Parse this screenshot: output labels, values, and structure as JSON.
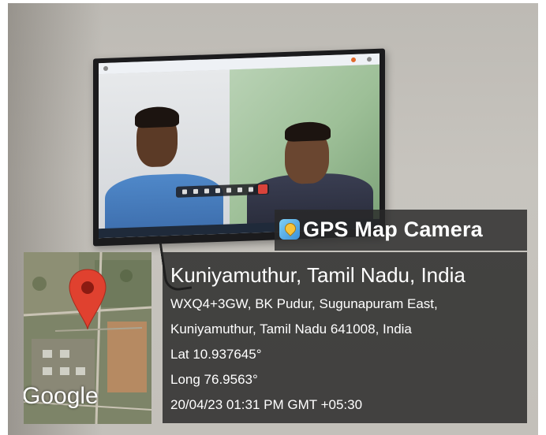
{
  "overlay": {
    "app_name": "GPS Map Camera",
    "place_title": "Kuniyamuthur, Tamil Nadu, India",
    "address_line1": "WXQ4+3GW, BK Pudur, Sugunapuram East,",
    "address_line2": "Kuniyamuthur, Tamil Nadu 641008, India",
    "latitude": "Lat 10.937645°",
    "longitude": "Long 76.9563°",
    "datetime": "20/04/23 01:31 PM GMT +05:30"
  },
  "map": {
    "provider_logo": "Google",
    "pin_icon": "map-pin-icon",
    "pin_color": "#e0412f"
  },
  "scene": {
    "description_icons": [
      "tv-icon",
      "person-icon"
    ]
  }
}
